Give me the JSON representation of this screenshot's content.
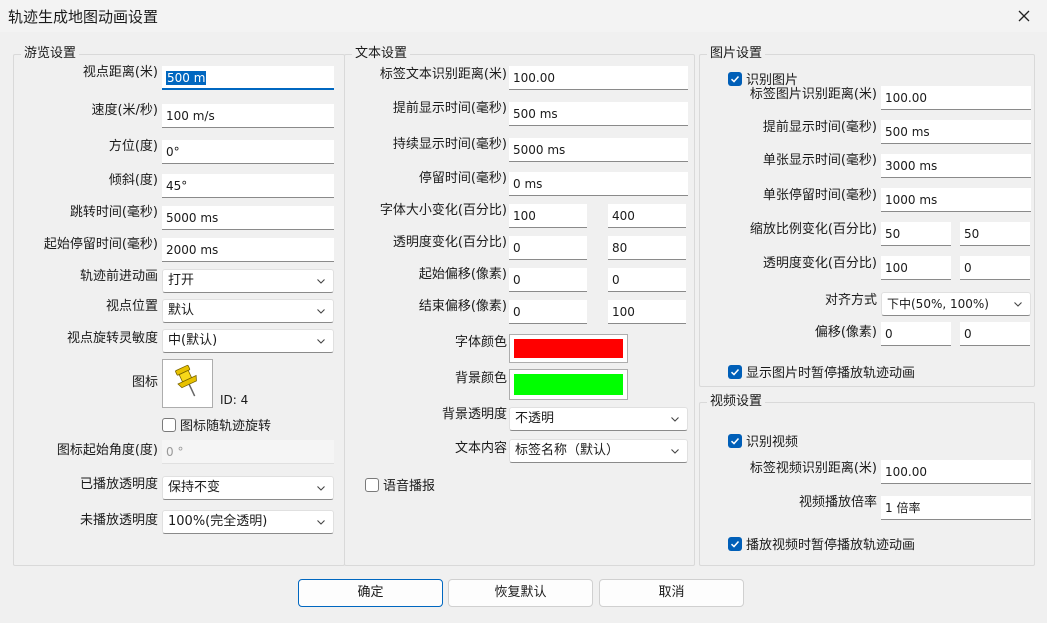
{
  "window": {
    "title": "轨迹生成地图动画设置"
  },
  "browse": {
    "title": "游览设置",
    "distance_label": "视点距离(米)",
    "distance_value": "500 m",
    "speed_label": "速度(米/秒)",
    "speed_value": "100 m/s",
    "azimuth_label": "方位(度)",
    "azimuth_value": "0°",
    "tilt_label": "倾斜(度)",
    "tilt_value": "45°",
    "jump_label": "跳转时间(毫秒)",
    "jump_value": "5000 ms",
    "start_stay_label": "起始停留时间(毫秒)",
    "start_stay_value": "2000 ms",
    "forward_anim_label": "轨迹前进动画",
    "forward_anim_value": "打开",
    "view_pos_label": "视点位置",
    "view_pos_value": "默认",
    "rot_sens_label": "视点旋转灵敏度",
    "rot_sens_value": "中(默认)",
    "icon_label": "图标",
    "icon_id": "ID: 4",
    "icon_rotate_label": "图标随轨迹旋转",
    "icon_rotate_checked": false,
    "icon_angle_label": "图标起始角度(度)",
    "icon_angle_value": "0 °",
    "played_opacity_label": "已播放透明度",
    "played_opacity_value": "保持不变",
    "unplayed_opacity_label": "未播放透明度",
    "unplayed_opacity_value": "100%(完全透明)"
  },
  "text": {
    "title": "文本设置",
    "rec_dist_label": "标签文本识别距离(米)",
    "rec_dist_value": "100.00",
    "advance_label": "提前显示时间(毫秒)",
    "advance_value": "500 ms",
    "duration_label": "持续显示时间(毫秒)",
    "duration_value": "5000 ms",
    "stay_label": "停留时间(毫秒)",
    "stay_value": "0 ms",
    "font_size_label": "字体大小变化(百分比)",
    "font_size_from": "100",
    "font_size_to": "400",
    "opacity_label": "透明度变化(百分比)",
    "opacity_from": "0",
    "opacity_to": "80",
    "start_offset_label": "起始偏移(像素)",
    "start_offset_x": "0",
    "start_offset_y": "0",
    "end_offset_label": "结束偏移(像素)",
    "end_offset_x": "0",
    "end_offset_y": "100",
    "font_color_label": "字体颜色",
    "font_color": "#ff0000",
    "bg_color_label": "背景颜色",
    "bg_color": "#00ff00",
    "bg_opacity_label": "背景透明度",
    "bg_opacity_value": "不透明",
    "content_label": "文本内容",
    "content_value": "标签名称（默认）",
    "voice_label": "语音播报",
    "voice_checked": false
  },
  "image": {
    "title": "图片设置",
    "recognize_label": "识别图片",
    "recognize_checked": true,
    "rec_dist_label": "标签图片识别距离(米)",
    "rec_dist_value": "100.00",
    "advance_label": "提前显示时间(毫秒)",
    "advance_value": "500 ms",
    "single_show_label": "单张显示时间(毫秒)",
    "single_show_value": "3000 ms",
    "single_stay_label": "单张停留时间(毫秒)",
    "single_stay_value": "1000 ms",
    "scale_label": "缩放比例变化(百分比)",
    "scale_from": "50",
    "scale_to": "50",
    "opacity_label": "透明度变化(百分比)",
    "opacity_from": "100",
    "opacity_to": "0",
    "align_label": "对齐方式",
    "align_value": "下中(50%, 100%)",
    "offset_label": "偏移(像素)",
    "offset_x": "0",
    "offset_y": "0",
    "pause_label": "显示图片时暂停播放轨迹动画",
    "pause_checked": true
  },
  "video": {
    "title": "视频设置",
    "recognize_label": "识别视频",
    "recognize_checked": true,
    "rec_dist_label": "标签视频识别距离(米)",
    "rec_dist_value": "100.00",
    "rate_label": "视频播放倍率",
    "rate_value": "1 倍率",
    "pause_label": "播放视频时暂停播放轨迹动画",
    "pause_checked": true
  },
  "buttons": {
    "ok": "确定",
    "reset": "恢复默认",
    "cancel": "取消"
  },
  "colors": {
    "accent": "#005fb8"
  }
}
